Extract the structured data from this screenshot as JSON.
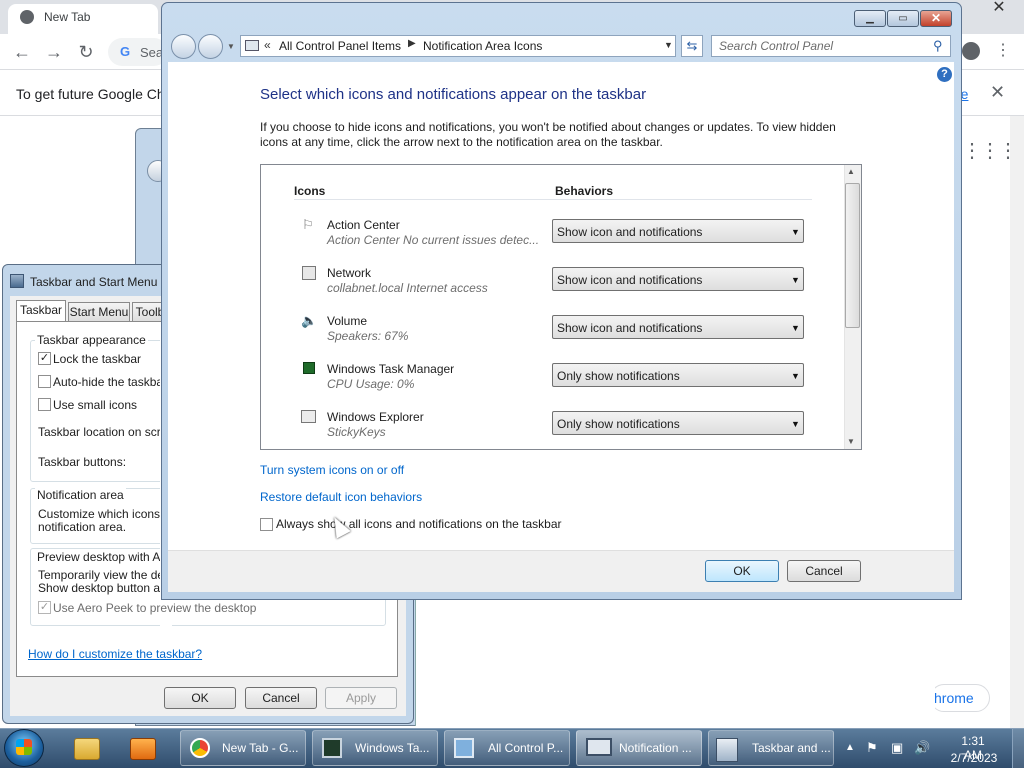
{
  "chrome": {
    "tab_title": "New Tab",
    "omnibox_text": "Sea",
    "infobar_text": "To get future Google Chrome",
    "infobar_link": "re",
    "pill_text": "hrome"
  },
  "taskbar_props": {
    "title": "Taskbar and Start Menu P",
    "tabs": [
      "Taskbar",
      "Start Menu",
      "Toolb"
    ],
    "appearance_title": "Taskbar appearance",
    "lock": "Lock the taskbar",
    "lock_checked": true,
    "autohide": "Auto-hide the taskbar",
    "small_icons": "Use small icons",
    "location": "Taskbar location on scree",
    "buttons": "Taskbar buttons:",
    "notif_title": "Notification area",
    "notif_text_1": "Customize which icons and",
    "notif_text_2": "notification area.",
    "peek_title": "Preview desktop with Aer",
    "peek_text_1": "Temporarily view the desk",
    "peek_text_2": "Show desktop button at e",
    "peek_checkbox": "Use Aero Peek to preview the desktop",
    "help_link": "How do I customize the taskbar?",
    "ok": "OK",
    "cancel": "Cancel",
    "apply": "Apply"
  },
  "notif": {
    "address": {
      "crumb1": "All Control Panel Items",
      "crumb2": "Notification Area Icons"
    },
    "search_placeholder": "Search Control Panel",
    "heading": "Select which icons and notifications appear on the taskbar",
    "description": "If you choose to hide icons and notifications, you won't be notified about changes or updates. To view hidden icons at any time, click the arrow next to the notification area on the taskbar.",
    "col_icons": "Icons",
    "col_behaviors": "Behaviors",
    "rows": [
      {
        "name": "Action Center",
        "sub": "Action Center  No current issues detec...",
        "behavior": "Show icon and notifications",
        "icon": "flag-icon"
      },
      {
        "name": "Network",
        "sub": "collabnet.local Internet access",
        "behavior": "Show icon and notifications",
        "icon": "network-icon"
      },
      {
        "name": "Volume",
        "sub": "Speakers: 67%",
        "behavior": "Show icon and notifications",
        "icon": "speaker-icon"
      },
      {
        "name": "Windows Task Manager",
        "sub": "CPU Usage: 0%",
        "behavior": "Only show notifications",
        "icon": "task-manager-icon"
      },
      {
        "name": "Windows Explorer",
        "sub": "StickyKeys",
        "behavior": "Only show notifications",
        "icon": "explorer-icon"
      }
    ],
    "link_system_icons": "Turn system icons on or off",
    "link_restore": "Restore default icon behaviors",
    "always_show": "Always show all icons and notifications on the taskbar",
    "always_show_checked": false,
    "ok": "OK",
    "cancel": "Cancel"
  },
  "taskbar": {
    "tasks": [
      {
        "label": "New Tab - G..."
      },
      {
        "label": "Windows Ta..."
      },
      {
        "label": "All Control P..."
      },
      {
        "label": "Notification ..."
      },
      {
        "label": "Taskbar and ..."
      }
    ],
    "clock_time": "1:31 AM",
    "clock_date": "2/7/2023"
  }
}
